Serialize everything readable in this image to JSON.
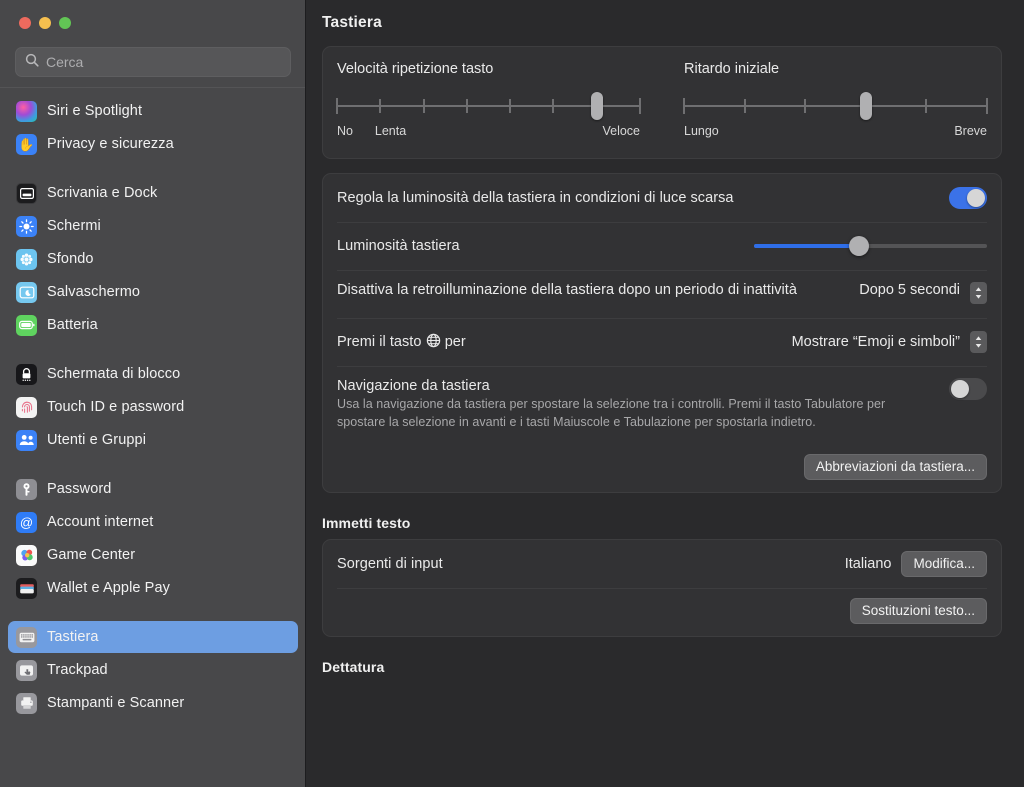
{
  "window": {
    "traffic_lights": [
      {
        "name": "close",
        "color": "#ed6a5e"
      },
      {
        "name": "minimize",
        "color": "#f5bf4f"
      },
      {
        "name": "zoom",
        "color": "#62c555"
      }
    ]
  },
  "sidebar": {
    "search": {
      "placeholder": "Cerca",
      "value": "",
      "icon": "search-icon"
    },
    "groups": [
      {
        "items": [
          {
            "label": "Siri e Spotlight",
            "icon": "siri-icon",
            "selected": false
          },
          {
            "label": "Privacy e sicurezza",
            "icon": "privacy-hand-icon",
            "selected": false
          }
        ]
      },
      {
        "items": [
          {
            "label": "Scrivania e Dock",
            "icon": "desktop-dock-icon",
            "selected": false
          },
          {
            "label": "Schermi",
            "icon": "displays-icon",
            "selected": false
          },
          {
            "label": "Sfondo",
            "icon": "wallpaper-icon",
            "selected": false
          },
          {
            "label": "Salvaschermo",
            "icon": "screensaver-icon",
            "selected": false
          },
          {
            "label": "Batteria",
            "icon": "battery-icon",
            "selected": false
          }
        ]
      },
      {
        "items": [
          {
            "label": "Schermata di blocco",
            "icon": "lock-screen-icon",
            "selected": false
          },
          {
            "label": "Touch ID e password",
            "icon": "touch-id-icon",
            "selected": false
          },
          {
            "label": "Utenti e Gruppi",
            "icon": "users-groups-icon",
            "selected": false
          }
        ]
      },
      {
        "items": [
          {
            "label": "Password",
            "icon": "password-key-icon",
            "selected": false
          },
          {
            "label": "Account internet",
            "icon": "internet-accounts-icon",
            "selected": false
          },
          {
            "label": "Game Center",
            "icon": "game-center-icon",
            "selected": false
          },
          {
            "label": "Wallet e Apple Pay",
            "icon": "wallet-icon",
            "selected": false
          }
        ]
      },
      {
        "items": [
          {
            "label": "Tastiera",
            "icon": "keyboard-icon",
            "selected": true
          },
          {
            "label": "Trackpad",
            "icon": "trackpad-icon",
            "selected": false
          },
          {
            "label": "Stampanti e Scanner",
            "icon": "printer-scanner-icon",
            "selected": false
          }
        ]
      }
    ]
  },
  "main": {
    "title": "Tastiera",
    "key_repeat": {
      "label": "Velocità ripetizione tasto",
      "min_label": "No",
      "second_label": "Lenta",
      "max_label": "Veloce",
      "ticks": 8,
      "value_index": 6
    },
    "initial_delay": {
      "label": "Ritardo iniziale",
      "min_label": "Lungo",
      "max_label": "Breve",
      "ticks": 6,
      "value_index": 3
    },
    "ambient": {
      "label": "Regola la luminosità della tastiera in condizioni di luce scarsa",
      "toggle_state": "on"
    },
    "brightness": {
      "label": "Luminosità tastiera",
      "value_percent": 45
    },
    "backlight_timeout": {
      "label": "Disattiva la retroilluminazione della tastiera dopo un periodo di inattività",
      "value": "Dopo 5 secondi"
    },
    "globe_key": {
      "label_before": "Premi il tasto",
      "label_after": "per",
      "icon": "globe-icon",
      "value": "Mostrare “Emoji e simboli”"
    },
    "keyboard_navigation": {
      "label": "Navigazione da tastiera",
      "description": "Usa la navigazione da tastiera per spostare la selezione tra i controlli. Premi il tasto Tabulatore per spostare la selezione in avanti e i tasti Maiuscole e Tabulazione per spostarla indietro.",
      "toggle_state": "off"
    },
    "shortcuts_button": "Abbreviazioni da tastiera...",
    "text_input": {
      "section_title": "Immetti testo",
      "input_sources_label": "Sorgenti di input",
      "input_sources_value": "Italiano",
      "edit_button": "Modifica...",
      "text_replacements_button": "Sostituzioni testo..."
    },
    "dictation": {
      "section_title": "Dettatura"
    }
  },
  "colors": {
    "accent_blue": "#3b72e8",
    "selection_blue": "#6d9ee2",
    "sidebar_bg": "#48484a",
    "main_bg": "#2a2a2c",
    "card_bg": "#323234"
  }
}
